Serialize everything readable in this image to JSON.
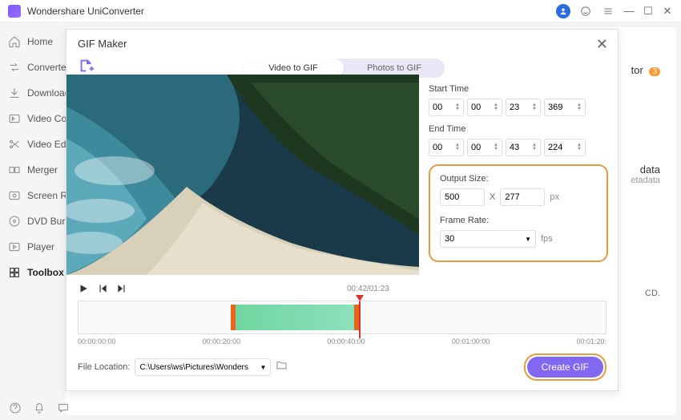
{
  "app": {
    "title": "Wondershare UniConverter"
  },
  "sidebar": {
    "items": [
      {
        "label": "Home"
      },
      {
        "label": "Converter"
      },
      {
        "label": "Downloader"
      },
      {
        "label": "Video Compressor"
      },
      {
        "label": "Video Editor"
      },
      {
        "label": "Merger"
      },
      {
        "label": "Screen Recorder"
      },
      {
        "label": "DVD Burner"
      },
      {
        "label": "Player"
      },
      {
        "label": "Toolbox"
      }
    ]
  },
  "bg": {
    "line1": "tor",
    "badge": "3",
    "data_label": "data",
    "data_sub": "etadata",
    "cd": "CD."
  },
  "modal": {
    "title": "GIF Maker",
    "tabs": {
      "video": "Video to GIF",
      "photos": "Photos to GIF"
    },
    "start_label": "Start Time",
    "end_label": "End Time",
    "start": {
      "h": "00",
      "m": "00",
      "s": "23",
      "ms": "369"
    },
    "end": {
      "h": "00",
      "m": "00",
      "s": "43",
      "ms": "224"
    },
    "output_size_label": "Output Size:",
    "width": "500",
    "height": "277",
    "size_unit": "px",
    "x_sep": "X",
    "frame_rate_label": "Frame Rate:",
    "frame_rate": "30",
    "rate_unit": "fps",
    "time_display": "00:42/01:23",
    "timeline_labels": [
      "00:00:00:00",
      "00:00:20:00",
      "00:00:40:00",
      "00:01:00:00",
      "00:01:20:"
    ],
    "file_loc_label": "File Location:",
    "file_loc": "C:\\Users\\ws\\Pictures\\Wonders",
    "create_btn": "Create GIF"
  }
}
